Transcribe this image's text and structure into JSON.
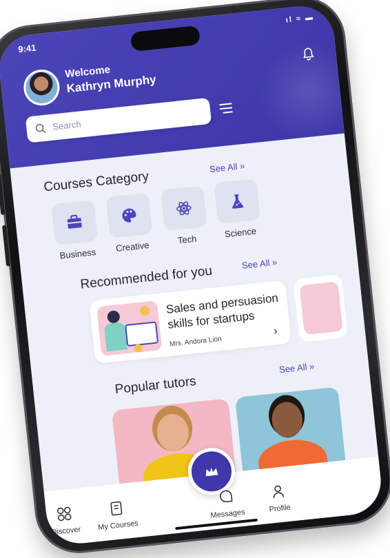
{
  "status_bar": {
    "time": "9:41",
    "icons": "ıl ≈ ▬"
  },
  "header": {
    "welcome": "Welcome",
    "user_name": "Kathryn Murphy"
  },
  "search": {
    "placeholder": "Search"
  },
  "courses_category": {
    "title": "Courses Category",
    "see_all": "See All  »",
    "items": [
      {
        "label": "Business",
        "icon": "briefcase-icon"
      },
      {
        "label": "Creative",
        "icon": "palette-icon"
      },
      {
        "label": "Tech",
        "icon": "atom-icon"
      },
      {
        "label": "Science",
        "icon": "flask-icon"
      }
    ]
  },
  "recommended": {
    "title": "Recommended for you",
    "see_all": "See All  »",
    "course": {
      "title": "Sales and persuasion skills for startups",
      "author": "Mrs. Andora Lion"
    }
  },
  "popular_tutors": {
    "title": "Popular tutors",
    "see_all": "See All  »"
  },
  "bottom_nav": {
    "items": [
      {
        "label": "Discover",
        "icon": "grid-icon"
      },
      {
        "label": "My Courses",
        "icon": "book-icon"
      },
      {
        "label": "Messages",
        "icon": "chat-icon"
      },
      {
        "label": "Profile",
        "icon": "user-icon"
      }
    ],
    "fab_icon": "crown-icon"
  },
  "colors": {
    "primary": "#4c45b8",
    "background": "#eef0f7",
    "tile": "#dfe2ef"
  }
}
